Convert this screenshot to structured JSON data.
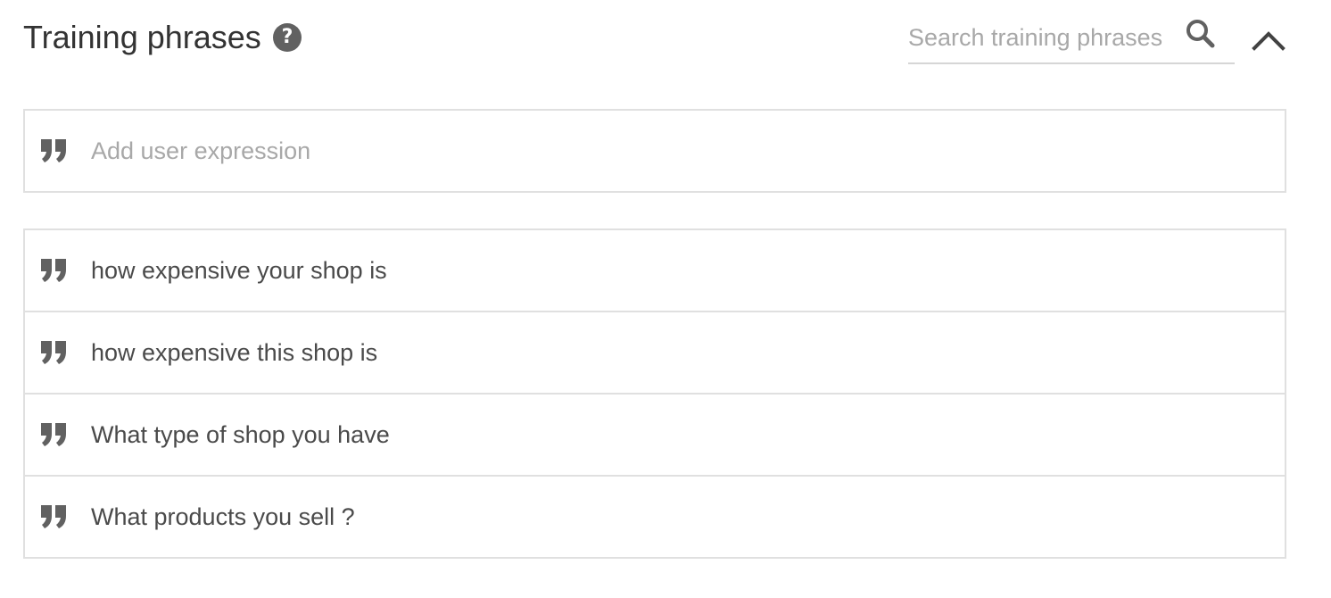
{
  "header": {
    "title": "Training phrases",
    "help_icon": "help-icon",
    "help_glyph": "?",
    "search": {
      "placeholder": "Search training phrases",
      "value": "",
      "icon": "search-icon"
    },
    "collapse_icon": "chevron-up-icon"
  },
  "add_expression": {
    "placeholder": "Add user expression",
    "value": "",
    "icon": "quote-icon"
  },
  "phrases": [
    {
      "text": "how expensive your shop is",
      "icon": "quote-icon"
    },
    {
      "text": "how expensive this shop is",
      "icon": "quote-icon"
    },
    {
      "text": "What type of shop you have",
      "icon": "quote-icon"
    },
    {
      "text": "What products you sell ?",
      "icon": "quote-icon"
    }
  ],
  "colors": {
    "text": "#4a4a4a",
    "placeholder": "#a8a8a8",
    "icon": "#616161",
    "border": "#e0e0e0"
  }
}
